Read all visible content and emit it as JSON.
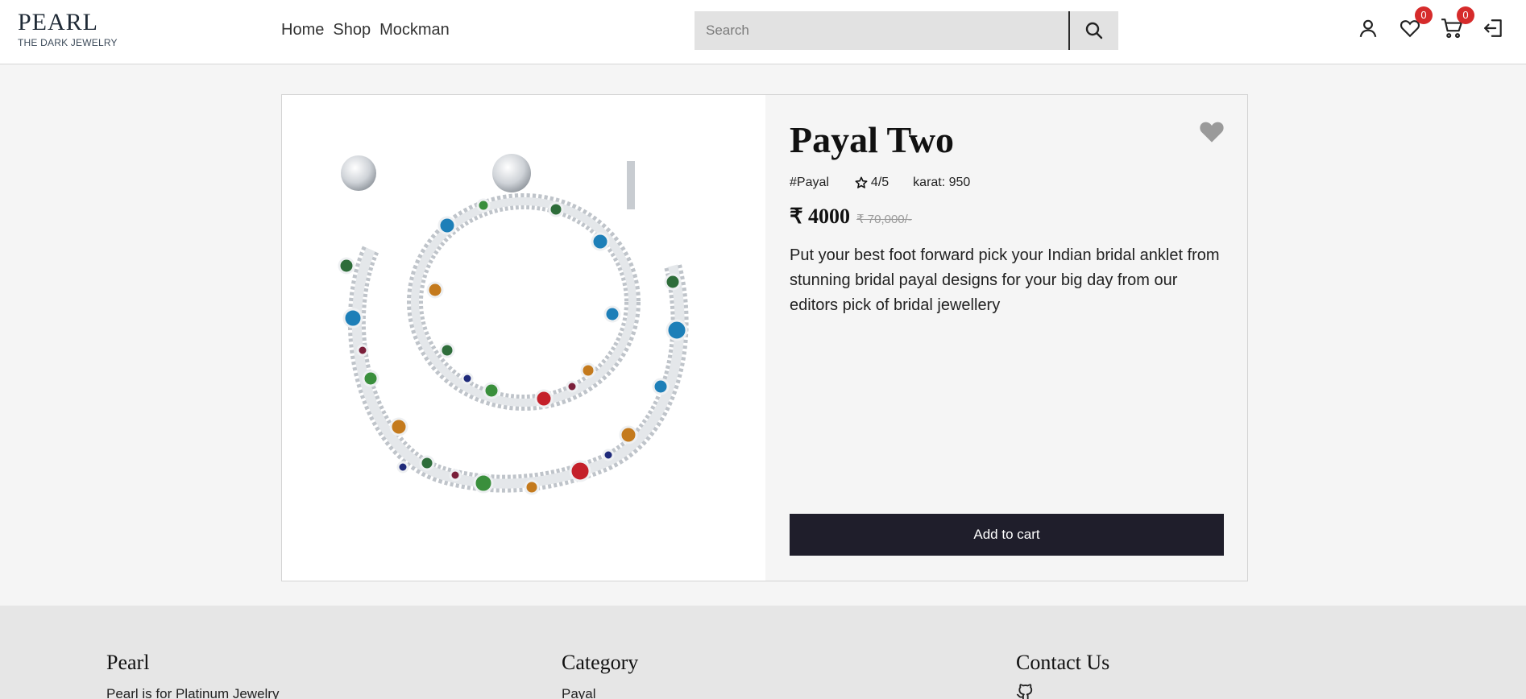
{
  "header": {
    "brand_name": "PEARL",
    "brand_tag": "THE DARK JEWELRY",
    "nav": [
      "Home",
      "Shop",
      "Mockman"
    ],
    "search_placeholder": "Search",
    "wishlist_count": "0",
    "cart_count": "0"
  },
  "product": {
    "title": "Payal Two",
    "tag": "#Payal",
    "rating": "4/5",
    "karat": "karat: 950",
    "price": "₹ 4000",
    "old_price": "₹ 70,000/-",
    "description": "Put your best foot forward pick your Indian bridal anklet from stunning bridal payal designs for your big day from our editors pick of bridal jewellery",
    "add_to_cart_label": "Add to cart"
  },
  "footer": {
    "col1_title": "Pearl",
    "col1_text": "Pearl is for Platinum Jewelry",
    "col2_title": "Category",
    "col2_text": "Payal",
    "col3_title": "Contact Us"
  },
  "colors": {
    "accent_dark": "#1f1e2b",
    "badge": "#d62b2b"
  }
}
